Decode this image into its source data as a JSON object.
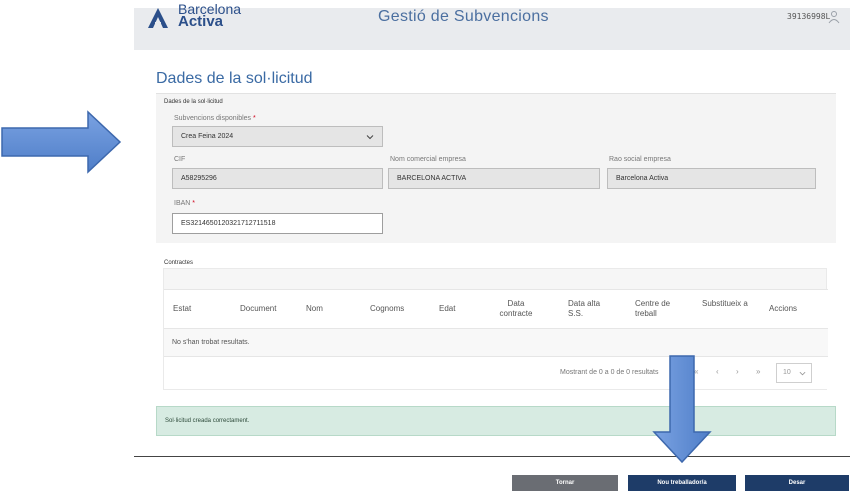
{
  "header": {
    "brand_top": "Barcelona",
    "brand_bottom": "Activa",
    "title": "Gestió de Subvencions",
    "user_id": "39136998L"
  },
  "page": {
    "title": "Dades de la sol·licitud",
    "section_legend": "Dades de la sol·licitud"
  },
  "form": {
    "subvencions": {
      "label": "Subvencions disponibles",
      "required_mark": "*",
      "value": "Crea Feina 2024"
    },
    "cif": {
      "label": "CIF",
      "value": "A58295296"
    },
    "nom_comercial": {
      "label": "Nom comercial empresa",
      "value": "BARCELONA ACTIVA"
    },
    "rao_social": {
      "label": "Rao social empresa",
      "value": "Barcelona Activa"
    },
    "iban": {
      "label": "IBAN",
      "required_mark": "*",
      "value": "ES3214650120321712711518"
    }
  },
  "contractes": {
    "legend": "Contractes",
    "columns": [
      "Estat",
      "Document",
      "Nom",
      "Cognoms",
      "Edat",
      "Data contracte",
      "Data alta S.S.",
      "Centre de treball",
      "Substitueix a",
      "Accions"
    ],
    "empty_text": "No s'han trobat resultats.",
    "pager_text": "Mostrant de 0 a 0 de 0 resultats",
    "page_size": "10"
  },
  "alert": {
    "text": "Sol·licitud creada correctament."
  },
  "buttons": {
    "tornar": "Tornar",
    "nou_treballador": "Nou treballador/a",
    "desar": "Desar"
  },
  "colors": {
    "brand": "#2b4f8a",
    "title": "#3a6aa4",
    "arrow": "#5b8bd6",
    "success_bg": "#d7ebe2",
    "button_navy": "#1e3c68",
    "button_grey": "#6a6d73"
  }
}
